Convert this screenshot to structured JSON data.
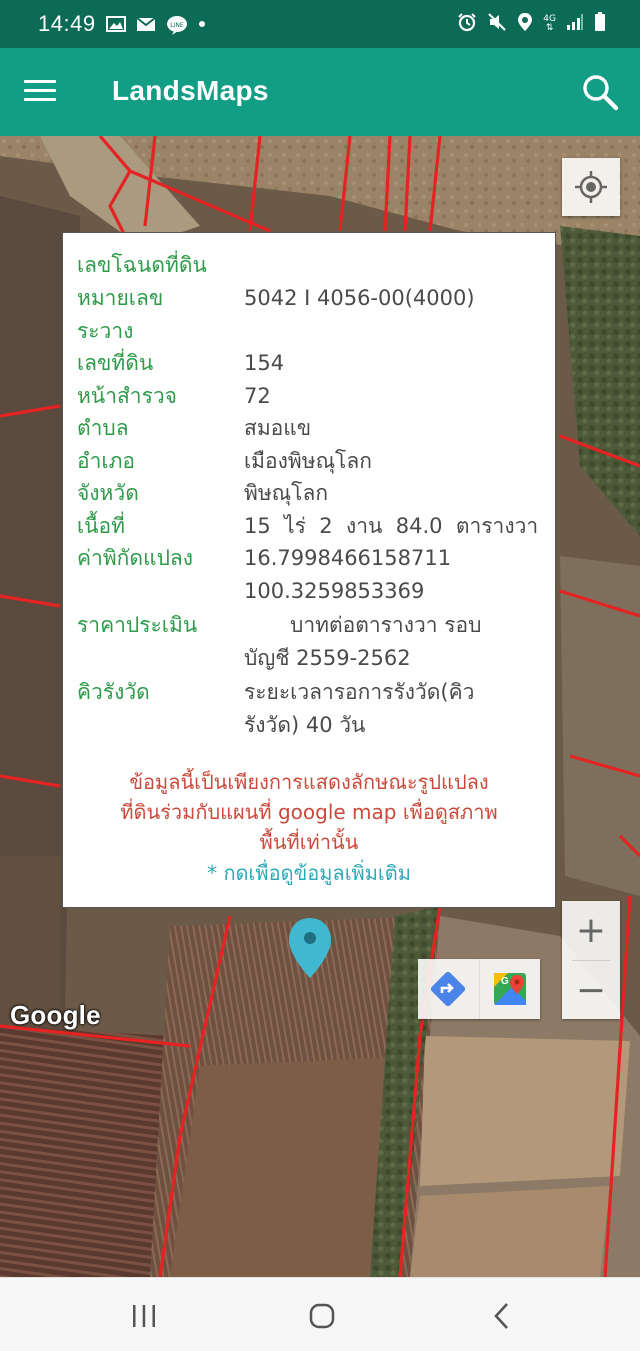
{
  "status_bar": {
    "time": "14:49",
    "icons_left": [
      "gallery-icon",
      "gmail-icon",
      "line-icon",
      "dot-icon"
    ],
    "icons_right": [
      "alarm-icon",
      "mute-icon",
      "location-icon",
      "network-4g-icon",
      "signal-icon",
      "battery-icon"
    ],
    "network_label": "4G"
  },
  "app_bar": {
    "title": "LandsMaps",
    "menu_icon": "hamburger-menu-icon",
    "search_icon": "search-icon",
    "color": "#119e85"
  },
  "info_window": {
    "heading": "เลขโฉนดที่ดิน",
    "rows": [
      {
        "label": "หมายเลข",
        "value": "5042 I 4056-00(4000)"
      },
      {
        "label": "ระวาง",
        "value": ""
      },
      {
        "label": "เลขที่ดิน",
        "value": "154"
      },
      {
        "label": "หน้าสำรวจ",
        "value": "72"
      },
      {
        "label": "ตำบล",
        "value": "สมอแข"
      },
      {
        "label": "อำเภอ",
        "value": "เมืองพิษณุโลก"
      },
      {
        "label": "จังหวัด",
        "value": "พิษณุโลก"
      },
      {
        "label": "เนื้อที่",
        "value": "15  ไร่  2  งาน  84.0  ตารางวา"
      }
    ],
    "coords": {
      "label": "ค่าพิกัดแปลง",
      "lat": "16.7998466158711",
      "lng": "100.3259853369"
    },
    "price": {
      "label": "ราคาประเมิน",
      "line1": "บาทต่อตารางวา รอบ",
      "line2": "บัญชี 2559-2562"
    },
    "queue": {
      "label": "คิวรังวัด",
      "line1": "ระยะเวลารอการรังวัด(คิว",
      "line2": "รังวัด) 40 วัน"
    },
    "note_lines": [
      "ข้อมูลนี้เป็นเพียงการแสดงลักษณะรูปแปลง",
      "ที่ดินร่วมกับแผนที่ google map เพื่อดูสภาพ",
      "พื้นที่เท่านั้น"
    ],
    "more_link": "* กดเพื่อดูข้อมูลเพิ่มเติม"
  },
  "map": {
    "attribution": "Google",
    "zoom_in": "+",
    "zoom_out": "−",
    "pin_color": "#3fb8d0",
    "boundary_color": "#e52323"
  },
  "nav_bar": {
    "buttons": [
      "recent-apps-icon",
      "home-icon",
      "back-icon"
    ]
  }
}
